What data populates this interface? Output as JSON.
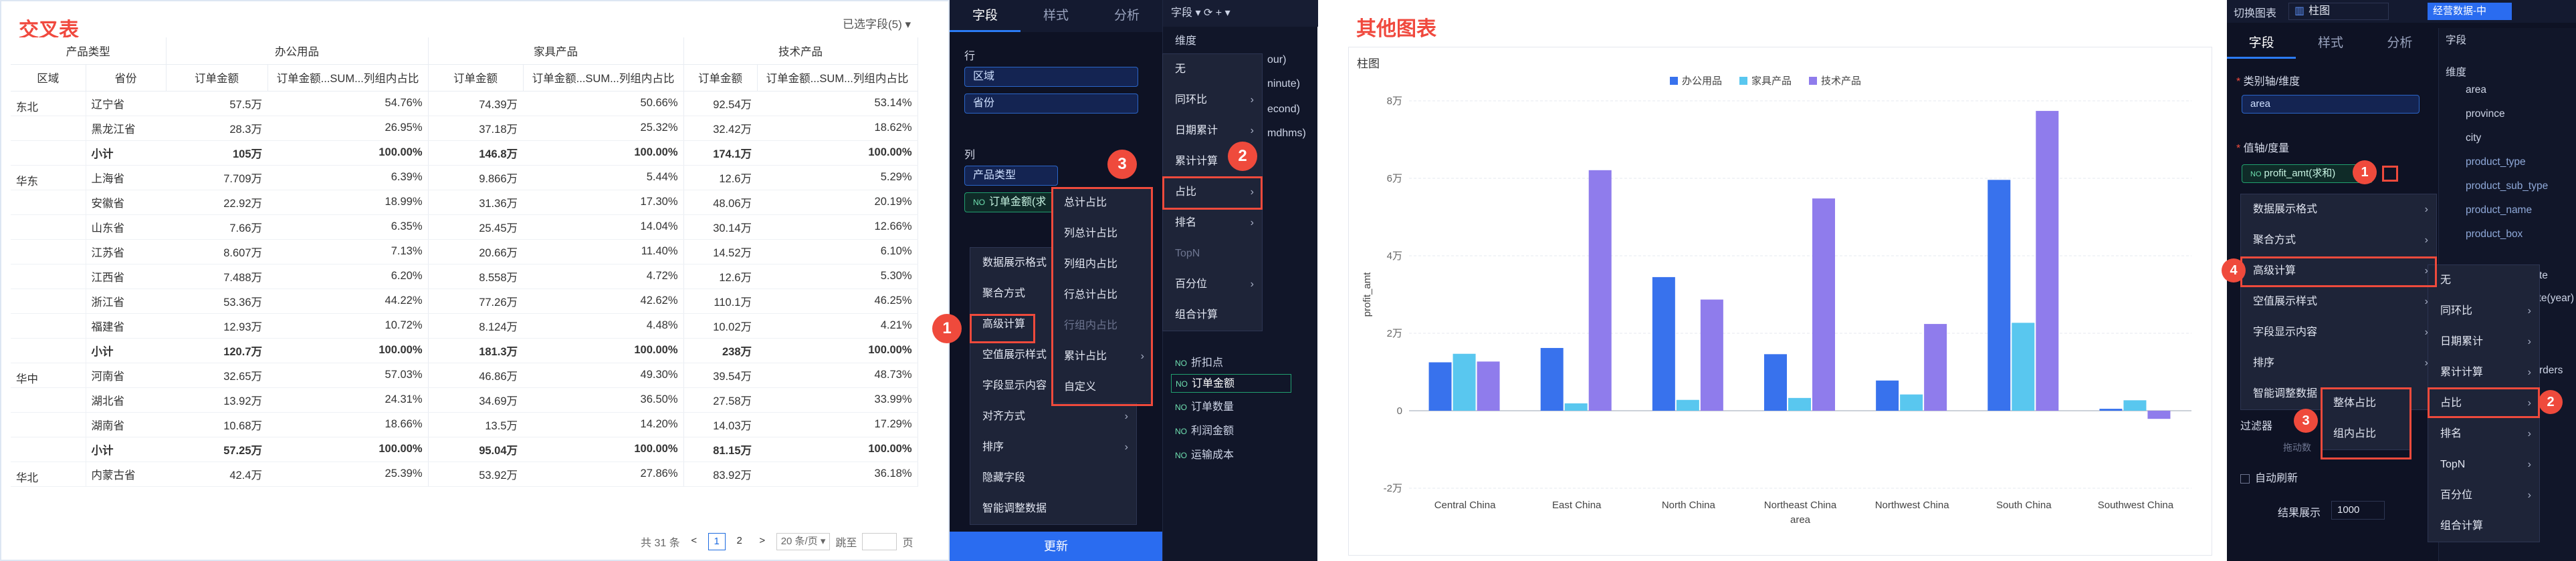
{
  "left": {
    "title": "交叉表",
    "selected_columns": "已选字段(5) ▾",
    "headers": {
      "group_type": "产品类型",
      "groups": [
        "办公用品",
        "家具产品",
        "技术产品"
      ],
      "region": "区域",
      "province": "省份",
      "amount": "订单金额",
      "ratio": "订单金额...SUM...列组内占比"
    },
    "rows": [
      {
        "region": "东北",
        "province": "辽宁省",
        "v": [
          "57.5万",
          "54.76%",
          "74.39万",
          "50.66%",
          "92.54万",
          "53.14%"
        ]
      },
      {
        "region": "",
        "province": "黑龙江省",
        "v": [
          "28.3万",
          "26.95%",
          "37.18万",
          "25.32%",
          "32.42万",
          "18.62%"
        ]
      },
      {
        "region": "",
        "province": "小计",
        "sub": true,
        "v": [
          "105万",
          "100.00%",
          "146.8万",
          "100.00%",
          "174.1万",
          "100.00%"
        ]
      },
      {
        "region": "华东",
        "province": "上海省",
        "v": [
          "7.709万",
          "6.39%",
          "9.866万",
          "5.44%",
          "12.6万",
          "5.29%"
        ]
      },
      {
        "region": "",
        "province": "安徽省",
        "v": [
          "22.92万",
          "18.99%",
          "31.36万",
          "17.30%",
          "48.06万",
          "20.19%"
        ]
      },
      {
        "region": "",
        "province": "山东省",
        "v": [
          "7.66万",
          "6.35%",
          "25.45万",
          "14.04%",
          "30.14万",
          "12.66%"
        ]
      },
      {
        "region": "",
        "province": "江苏省",
        "v": [
          "8.607万",
          "7.13%",
          "20.66万",
          "11.40%",
          "14.52万",
          "6.10%"
        ]
      },
      {
        "region": "",
        "province": "江西省",
        "v": [
          "7.488万",
          "6.20%",
          "8.558万",
          "4.72%",
          "12.6万",
          "5.30%"
        ]
      },
      {
        "region": "",
        "province": "浙江省",
        "v": [
          "53.36万",
          "44.22%",
          "77.26万",
          "42.62%",
          "110.1万",
          "46.25%"
        ]
      },
      {
        "region": "",
        "province": "福建省",
        "v": [
          "12.93万",
          "10.72%",
          "8.124万",
          "4.48%",
          "10.02万",
          "4.21%"
        ]
      },
      {
        "region": "",
        "province": "小计",
        "sub": true,
        "v": [
          "120.7万",
          "100.00%",
          "181.3万",
          "100.00%",
          "238万",
          "100.00%"
        ]
      },
      {
        "region": "华中",
        "province": "河南省",
        "v": [
          "32.65万",
          "57.03%",
          "46.86万",
          "49.30%",
          "39.54万",
          "48.73%"
        ]
      },
      {
        "region": "",
        "province": "湖北省",
        "v": [
          "13.92万",
          "24.31%",
          "34.69万",
          "36.50%",
          "27.58万",
          "33.99%"
        ]
      },
      {
        "region": "",
        "province": "湖南省",
        "v": [
          "10.68万",
          "18.66%",
          "13.5万",
          "14.20%",
          "14.03万",
          "17.29%"
        ]
      },
      {
        "region": "",
        "province": "小计",
        "sub": true,
        "v": [
          "57.25万",
          "100.00%",
          "95.04万",
          "100.00%",
          "81.15万",
          "100.00%"
        ]
      },
      {
        "region": "华北",
        "province": "内蒙古省",
        "v": [
          "42.4万",
          "25.39%",
          "53.92万",
          "27.86%",
          "83.92万",
          "36.18%"
        ]
      }
    ],
    "pager": {
      "total": "共 31 条",
      "prev": "<",
      "p1": "1",
      "p2": "2",
      "next": ">",
      "size": "20 条/页 ▾",
      "jump": "跳至",
      "page_unit": "页"
    }
  },
  "mid": {
    "tabs": [
      "字段",
      "样式",
      "分析"
    ],
    "row_label": "行",
    "row_pills": [
      "区域",
      "省份"
    ],
    "col_label": "列",
    "col_pills": [
      "产品类型",
      "订单金额(求"
    ],
    "col_pill_tag": "NO",
    "fields_header": "字段 ▾ ⟳ + ▾",
    "dim_label": "维度",
    "dim_peek": [
      "our)",
      "ninute)",
      "econd)",
      "mdhms)"
    ],
    "measures": [
      "折扣点",
      "订单金额",
      "订单数量",
      "利润金额",
      "运输成本"
    ],
    "measure_tag": "NO",
    "menu_main": [
      "数据展示格式",
      "聚合方式",
      "高级计算",
      "空值展示样式",
      "字段显示内容",
      "对齐方式",
      "排序",
      "隐藏字段",
      "智能调整数据"
    ],
    "menu_calc": [
      "无",
      "同环比",
      "日期累计",
      "累计计算",
      "占比",
      "排名",
      "TopN",
      "百分位",
      "组合计算"
    ],
    "menu_ratio": [
      "总计占比",
      "列总计占比",
      "列组内占比",
      "行总计占比",
      "行组内占比",
      "累计占比",
      "自定义"
    ],
    "badges": [
      "1",
      "2",
      "3"
    ],
    "update": "更新"
  },
  "chart": {
    "title": "其他图表",
    "card_name": "柱图"
  },
  "chart_data": {
    "type": "bar",
    "categories": [
      "Central China",
      "East China",
      "North China",
      "Northeast China",
      "Northwest China",
      "South China",
      "Southwest China"
    ],
    "series": [
      {
        "name": "办公用品",
        "values": [
          1.25,
          1.62,
          3.45,
          1.46,
          0.78,
          5.96,
          0.05
        ]
      },
      {
        "name": "家具产品",
        "values": [
          1.47,
          0.19,
          0.28,
          0.33,
          0.42,
          2.27,
          0.27
        ]
      },
      {
        "name": "技术产品",
        "values": [
          1.27,
          6.21,
          2.87,
          5.48,
          2.24,
          7.74,
          -0.21
        ]
      }
    ],
    "xlabel": "area",
    "ylabel": "profit_amt",
    "ylim": [
      -2,
      8
    ],
    "yticks": [
      -2,
      0,
      2,
      4,
      6,
      8
    ],
    "ytick_labels": [
      "-2万",
      "0",
      "2万",
      "4万",
      "6万",
      "8万"
    ],
    "colors": [
      "#3872ed",
      "#59c7ef",
      "#8f7cec"
    ],
    "legend": "top-center",
    "grid": true
  },
  "far": {
    "switch_label": "切换图表",
    "chart_type": "柱图",
    "top_btn": "经营数据-中",
    "tabs": [
      "字段",
      "样式",
      "分析"
    ],
    "dim_label": "类别轴/维度",
    "dim_pill": "area",
    "measure_label": "值轴/度量",
    "measure_pill": "profit_amt(求和)",
    "measure_tag": "NO",
    "field_header": "字段",
    "dims_label": "维度",
    "dims": [
      "area",
      "province",
      "city",
      "product_type",
      "product_sub_type",
      "product_name",
      "product_box"
    ],
    "menu_main": [
      "数据展示格式",
      "聚合方式",
      "高级计算",
      "空值展示样式",
      "字段显示内容",
      "排序",
      "智能调整数据"
    ],
    "menu_calc": [
      "无",
      "同环比",
      "日期累计",
      "累计计算",
      "占比",
      "排名",
      "TopN",
      "百分位",
      "组合计算"
    ],
    "menu_ratio": [
      "整体占比",
      "组内占比"
    ],
    "filter_label": "过滤器",
    "drag_hint": "拖动数",
    "auto_refresh": "自动刷新",
    "result_label": "结果展示",
    "result_value": "1000",
    "peek": [
      "te",
      "ate(year)",
      "rders"
    ],
    "badges": [
      "1",
      "2",
      "3",
      "4"
    ]
  }
}
